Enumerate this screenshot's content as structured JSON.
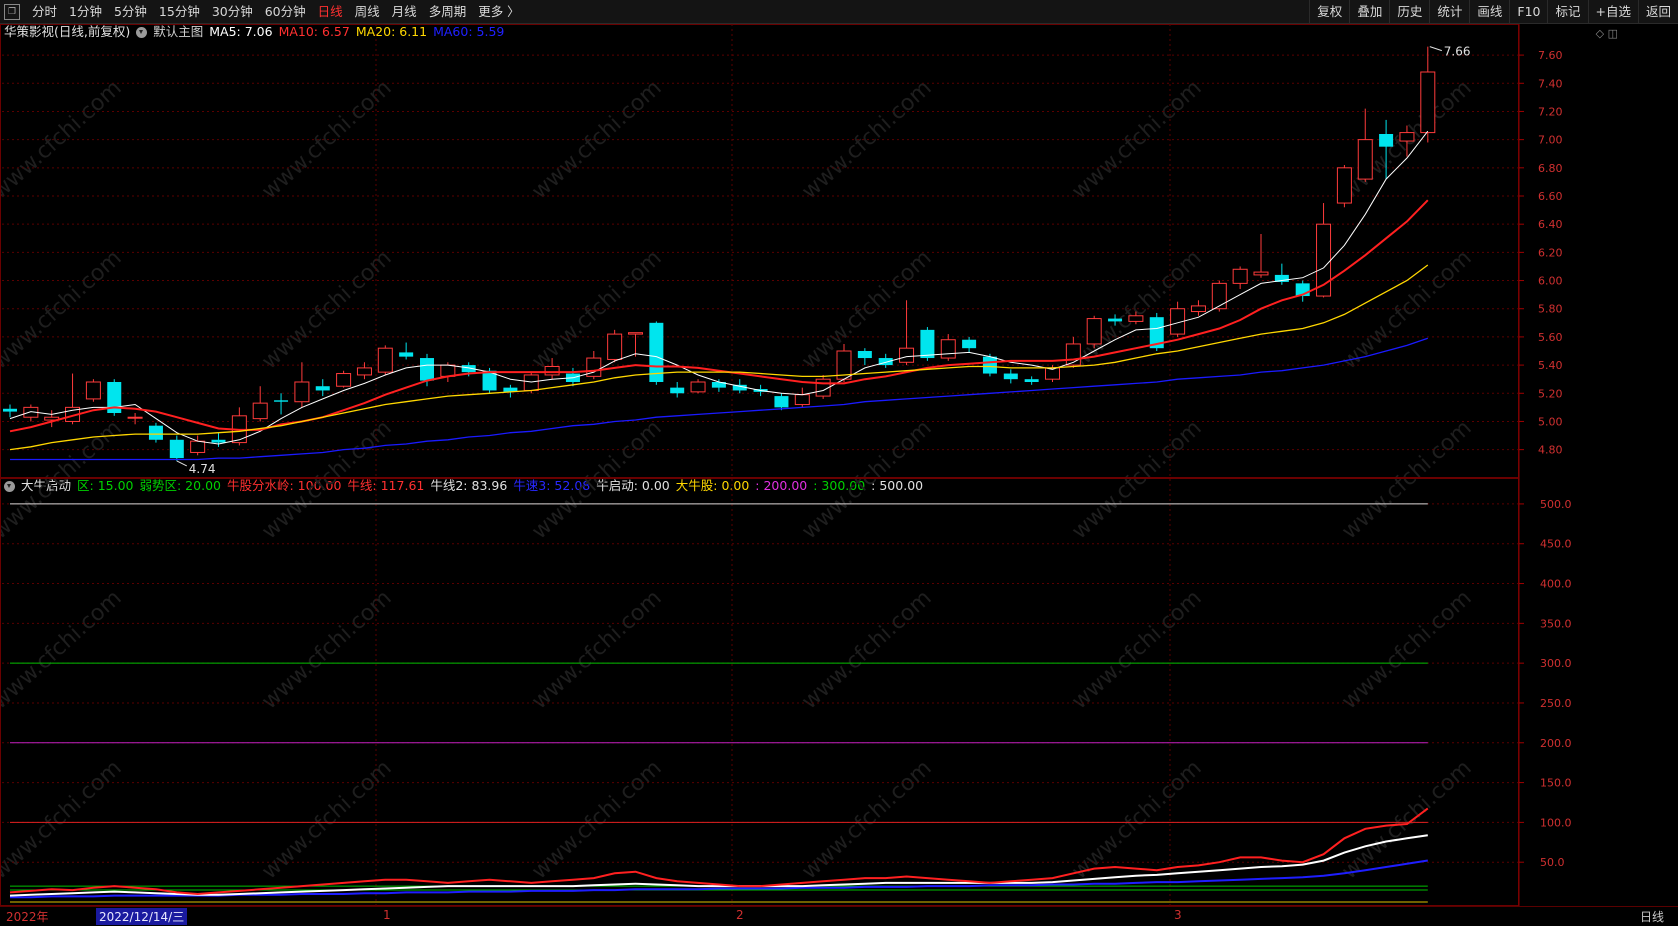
{
  "toolbar": {
    "left": [
      "分时",
      "1分钟",
      "5分钟",
      "15分钟",
      "30分钟",
      "60分钟",
      "日线",
      "周线",
      "月线",
      "多周期",
      "更多 〉"
    ],
    "active": "日线",
    "right": [
      "复权",
      "叠加",
      "历史",
      "统计",
      "画线",
      "F10",
      "标记",
      "+自选",
      "返回"
    ]
  },
  "main_legend": {
    "name": "华策影视(日线,前复权)",
    "template": "默认主图",
    "ma": [
      {
        "label": "MA5: 7.06",
        "color": "#ffffff"
      },
      {
        "label": "MA10: 6.57",
        "color": "#ff3030"
      },
      {
        "label": "MA20: 6.11",
        "color": "#ffd700"
      },
      {
        "label": "MA60: 5.59",
        "color": "#2020ff"
      }
    ]
  },
  "sub_legend": {
    "name": "大牛启动",
    "items": [
      {
        "label": "区: 15.00",
        "color": "#00d000"
      },
      {
        "label": "弱势区: 20.00",
        "color": "#00d000"
      },
      {
        "label": "牛股分水岭: 100.00",
        "color": "#ff3030"
      },
      {
        "label": "牛线: 117.61",
        "color": "#ff3030"
      },
      {
        "label": "牛线2: 83.96",
        "color": "#e0e0e0"
      },
      {
        "label": "牛速3: 52.08",
        "color": "#2828ff"
      },
      {
        "label": "牛启动: 0.00",
        "color": "#e0e0e0"
      },
      {
        "label": "大牛股: 0.00",
        "color": "#ffd700"
      },
      {
        "label": ": 200.00",
        "color": "#e030e0"
      },
      {
        "label": ": 300.00",
        "color": "#00d000"
      },
      {
        "label": ": 500.00",
        "color": "#e0e0e0"
      }
    ]
  },
  "price_axis": [
    "7.60",
    "7.40",
    "7.20",
    "7.00",
    "6.80",
    "6.60",
    "6.40",
    "6.20",
    "6.00",
    "5.80",
    "5.60",
    "5.40",
    "5.20",
    "5.00",
    "4.80"
  ],
  "sub_axis": [
    "500.0",
    "450.0",
    "400.0",
    "350.0",
    "300.0",
    "250.0",
    "200.0",
    "150.0",
    "100.0",
    "50.0"
  ],
  "annotations": {
    "high": "7.66",
    "low": "4.74"
  },
  "bottom_axis": {
    "year": "2022年",
    "date": "2022/12/14/三",
    "months": [
      "1",
      "2",
      "3"
    ],
    "period": "日线"
  },
  "watermark": "www.cfchi.com",
  "chart_data": {
    "type": "candlestick",
    "title": "华策影视(日线,前复权)",
    "ylim": [
      4.62,
      7.7
    ],
    "candles": [
      [
        5.09,
        5.07,
        5.12,
        5.03
      ],
      [
        5.03,
        5.1,
        5.12,
        5.0
      ],
      [
        5.01,
        5.03,
        5.08,
        4.96
      ],
      [
        5.0,
        5.1,
        5.34,
        4.98
      ],
      [
        5.16,
        5.28,
        5.3,
        5.14
      ],
      [
        5.28,
        5.06,
        5.3,
        5.04
      ],
      [
        5.03,
        5.03,
        5.06,
        4.98
      ],
      [
        4.97,
        4.87,
        4.99,
        4.85
      ],
      [
        4.87,
        4.74,
        4.9,
        4.72
      ],
      [
        4.78,
        4.86,
        4.9,
        4.76
      ],
      [
        4.87,
        4.85,
        4.92,
        4.82
      ],
      [
        4.85,
        5.04,
        5.1,
        4.83
      ],
      [
        5.02,
        5.13,
        5.25,
        5.0
      ],
      [
        5.15,
        5.14,
        5.2,
        5.05
      ],
      [
        5.14,
        5.28,
        5.42,
        5.1
      ],
      [
        5.25,
        5.22,
        5.3,
        5.18
      ],
      [
        5.25,
        5.34,
        5.36,
        5.24
      ],
      [
        5.33,
        5.38,
        5.42,
        5.3
      ],
      [
        5.35,
        5.52,
        5.54,
        5.33
      ],
      [
        5.49,
        5.46,
        5.56,
        5.44
      ],
      [
        5.45,
        5.29,
        5.48,
        5.25
      ],
      [
        5.32,
        5.4,
        5.42,
        5.28
      ],
      [
        5.4,
        5.35,
        5.42,
        5.32
      ],
      [
        5.36,
        5.22,
        5.38,
        5.2
      ],
      [
        5.24,
        5.21,
        5.26,
        5.17
      ],
      [
        5.22,
        5.33,
        5.35,
        5.2
      ],
      [
        5.33,
        5.39,
        5.45,
        5.3
      ],
      [
        5.34,
        5.28,
        5.38,
        5.25
      ],
      [
        5.32,
        5.45,
        5.5,
        5.3
      ],
      [
        5.44,
        5.62,
        5.65,
        5.42
      ],
      [
        5.62,
        5.63,
        5.63,
        5.46
      ],
      [
        5.7,
        5.28,
        5.71,
        5.26
      ],
      [
        5.24,
        5.2,
        5.28,
        5.17
      ],
      [
        5.21,
        5.28,
        5.3,
        5.2
      ],
      [
        5.28,
        5.24,
        5.3,
        5.21
      ],
      [
        5.26,
        5.22,
        5.3,
        5.2
      ],
      [
        5.23,
        5.21,
        5.26,
        5.18
      ],
      [
        5.18,
        5.1,
        5.2,
        5.08
      ],
      [
        5.12,
        5.19,
        5.24,
        5.1
      ],
      [
        5.18,
        5.3,
        5.33,
        5.16
      ],
      [
        5.3,
        5.5,
        5.55,
        5.28
      ],
      [
        5.5,
        5.45,
        5.52,
        5.4
      ],
      [
        5.45,
        5.4,
        5.48,
        5.38
      ],
      [
        5.42,
        5.52,
        5.86,
        5.4
      ],
      [
        5.65,
        5.45,
        5.67,
        5.43
      ],
      [
        5.45,
        5.58,
        5.62,
        5.43
      ],
      [
        5.58,
        5.52,
        5.6,
        5.49
      ],
      [
        5.46,
        5.34,
        5.48,
        5.32
      ],
      [
        5.34,
        5.3,
        5.37,
        5.27
      ],
      [
        5.3,
        5.28,
        5.32,
        5.26
      ],
      [
        5.3,
        5.38,
        5.4,
        5.28
      ],
      [
        5.4,
        5.55,
        5.6,
        5.38
      ],
      [
        5.55,
        5.73,
        5.75,
        5.52
      ],
      [
        5.73,
        5.71,
        5.76,
        5.68
      ],
      [
        5.71,
        5.75,
        5.78,
        5.69
      ],
      [
        5.74,
        5.52,
        5.77,
        5.5
      ],
      [
        5.62,
        5.8,
        5.85,
        5.6
      ],
      [
        5.78,
        5.82,
        5.86,
        5.75
      ],
      [
        5.8,
        5.98,
        6.0,
        5.78
      ],
      [
        5.98,
        6.08,
        6.1,
        5.94
      ],
      [
        6.04,
        6.06,
        6.33,
        6.02
      ],
      [
        6.04,
        5.99,
        6.12,
        5.97
      ],
      [
        5.98,
        5.89,
        6.0,
        5.85
      ],
      [
        5.89,
        6.4,
        6.55,
        5.88
      ],
      [
        6.55,
        6.8,
        6.82,
        6.52
      ],
      [
        6.72,
        7.0,
        7.22,
        6.7
      ],
      [
        7.04,
        6.95,
        7.14,
        6.72
      ],
      [
        6.99,
        7.05,
        7.1,
        6.88
      ],
      [
        7.05,
        7.48,
        7.66,
        6.98
      ]
    ],
    "ma": {
      "MA5": [
        5.02,
        5.07,
        5.05,
        5.08,
        5.1,
        5.1,
        5.12,
        5.02,
        4.92,
        4.86,
        4.84,
        4.87,
        4.93,
        5.02,
        5.1,
        5.16,
        5.22,
        5.27,
        5.33,
        5.38,
        5.4,
        5.4,
        5.38,
        5.35,
        5.3,
        5.28,
        5.3,
        5.31,
        5.35,
        5.43,
        5.48,
        5.46,
        5.4,
        5.33,
        5.28,
        5.25,
        5.22,
        5.2,
        5.19,
        5.22,
        5.3,
        5.38,
        5.42,
        5.46,
        5.47,
        5.48,
        5.49,
        5.46,
        5.42,
        5.4,
        5.37,
        5.42,
        5.5,
        5.58,
        5.65,
        5.66,
        5.7,
        5.74,
        5.82,
        5.9,
        5.98,
        6.0,
        6.02,
        6.09,
        6.25,
        6.47,
        6.72,
        6.87,
        7.06
      ],
      "MA10": [
        4.93,
        4.96,
        5.0,
        5.04,
        5.08,
        5.1,
        5.09,
        5.07,
        5.03,
        4.99,
        4.95,
        4.94,
        4.94,
        4.98,
        5.0,
        5.03,
        5.08,
        5.13,
        5.19,
        5.24,
        5.29,
        5.32,
        5.34,
        5.35,
        5.35,
        5.35,
        5.35,
        5.35,
        5.36,
        5.38,
        5.4,
        5.39,
        5.39,
        5.38,
        5.36,
        5.34,
        5.32,
        5.3,
        5.28,
        5.27,
        5.27,
        5.3,
        5.32,
        5.35,
        5.38,
        5.4,
        5.41,
        5.42,
        5.43,
        5.43,
        5.43,
        5.44,
        5.46,
        5.49,
        5.52,
        5.55,
        5.58,
        5.62,
        5.66,
        5.72,
        5.8,
        5.86,
        5.9,
        5.97,
        6.07,
        6.18,
        6.3,
        6.42,
        6.57
      ],
      "MA20": [
        4.8,
        4.82,
        4.85,
        4.87,
        4.89,
        4.9,
        4.91,
        4.91,
        4.91,
        4.91,
        4.92,
        4.93,
        4.95,
        4.97,
        5.0,
        5.03,
        5.06,
        5.09,
        5.12,
        5.14,
        5.16,
        5.18,
        5.19,
        5.2,
        5.21,
        5.22,
        5.24,
        5.26,
        5.28,
        5.31,
        5.33,
        5.34,
        5.35,
        5.35,
        5.35,
        5.35,
        5.34,
        5.33,
        5.32,
        5.32,
        5.33,
        5.34,
        5.35,
        5.36,
        5.37,
        5.38,
        5.39,
        5.39,
        5.38,
        5.38,
        5.38,
        5.39,
        5.4,
        5.42,
        5.45,
        5.48,
        5.5,
        5.53,
        5.56,
        5.59,
        5.62,
        5.64,
        5.66,
        5.7,
        5.76,
        5.84,
        5.92,
        6.0,
        6.11
      ],
      "MA60": [
        4.73,
        4.73,
        4.73,
        4.73,
        4.73,
        4.73,
        4.73,
        4.73,
        4.73,
        4.73,
        4.74,
        4.74,
        4.75,
        4.76,
        4.77,
        4.78,
        4.8,
        4.81,
        4.83,
        4.84,
        4.86,
        4.87,
        4.89,
        4.9,
        4.92,
        4.93,
        4.95,
        4.97,
        4.98,
        5.0,
        5.01,
        5.03,
        5.04,
        5.05,
        5.06,
        5.07,
        5.08,
        5.09,
        5.1,
        5.11,
        5.12,
        5.14,
        5.15,
        5.16,
        5.17,
        5.18,
        5.19,
        5.2,
        5.21,
        5.22,
        5.23,
        5.24,
        5.25,
        5.26,
        5.27,
        5.28,
        5.3,
        5.31,
        5.32,
        5.33,
        5.35,
        5.36,
        5.38,
        5.4,
        5.43,
        5.46,
        5.5,
        5.54,
        5.59
      ]
    },
    "indicator": {
      "ylim": [
        0,
        520
      ],
      "levels": [
        {
          "value": 500,
          "color": "#d8d8d8"
        },
        {
          "value": 300,
          "color": "#00c000"
        },
        {
          "value": 200,
          "color": "#c020c0"
        },
        {
          "value": 100,
          "color": "#e02020"
        },
        {
          "value": 20,
          "color": "#00c000"
        },
        {
          "value": 15,
          "color": "#00c000"
        },
        {
          "value": 0,
          "color": "#e0c000"
        }
      ],
      "niu_xian": [
        12,
        14,
        16,
        15,
        18,
        20,
        18,
        16,
        12,
        10,
        12,
        14,
        16,
        18,
        20,
        22,
        24,
        26,
        28,
        28,
        26,
        24,
        26,
        28,
        26,
        24,
        26,
        28,
        30,
        36,
        38,
        30,
        26,
        24,
        22,
        20,
        20,
        22,
        24,
        26,
        28,
        30,
        30,
        32,
        30,
        28,
        26,
        24,
        26,
        28,
        30,
        36,
        42,
        44,
        42,
        40,
        44,
        46,
        50,
        56,
        56,
        52,
        50,
        60,
        80,
        92,
        96,
        98,
        117.61
      ],
      "niu_xian2": [
        8,
        9,
        10,
        11,
        12,
        13,
        12,
        11,
        10,
        9,
        9,
        10,
        11,
        12,
        13,
        14,
        15,
        16,
        17,
        18,
        19,
        20,
        20,
        20,
        20,
        20,
        20,
        20,
        21,
        22,
        23,
        22,
        21,
        20,
        20,
        20,
        20,
        20,
        20,
        21,
        22,
        23,
        24,
        24,
        24,
        24,
        24,
        24,
        24,
        24,
        25,
        27,
        29,
        31,
        33,
        34,
        36,
        38,
        40,
        42,
        44,
        45,
        47,
        52,
        62,
        70,
        76,
        80,
        83.96
      ],
      "niu_su3": [
        6,
        6,
        7,
        7,
        7,
        8,
        8,
        8,
        8,
        8,
        8,
        9,
        9,
        9,
        10,
        10,
        10,
        11,
        11,
        12,
        12,
        12,
        13,
        13,
        13,
        14,
        14,
        14,
        15,
        15,
        16,
        16,
        16,
        16,
        17,
        17,
        17,
        17,
        18,
        18,
        18,
        19,
        19,
        19,
        20,
        20,
        20,
        21,
        21,
        21,
        22,
        22,
        23,
        23,
        24,
        25,
        25,
        26,
        27,
        28,
        29,
        30,
        31,
        33,
        36,
        40,
        44,
        48,
        52.08
      ]
    }
  }
}
